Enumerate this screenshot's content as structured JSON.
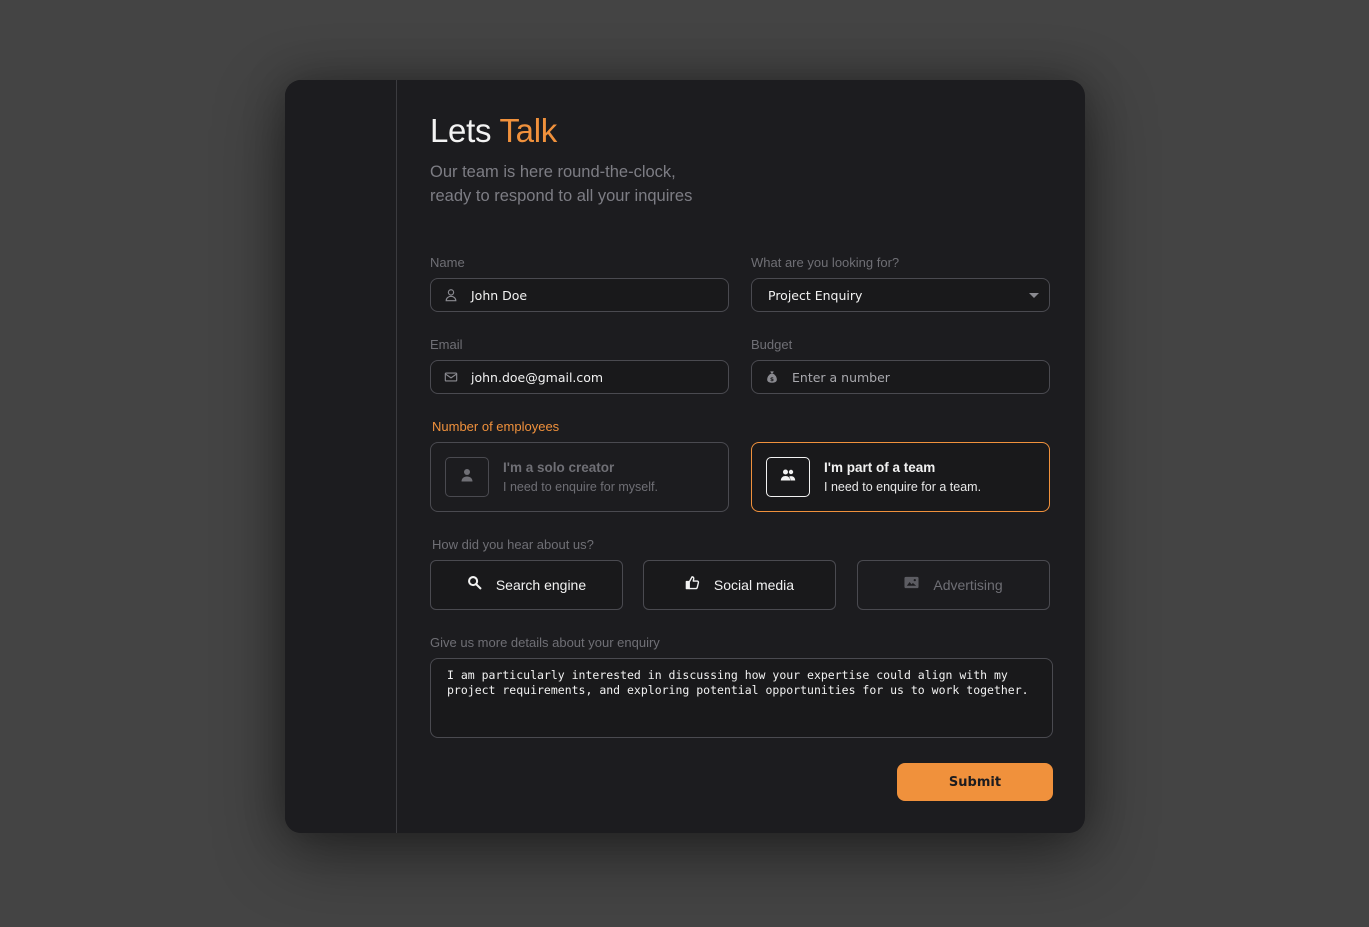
{
  "header": {
    "title_main": "Lets",
    "title_accent": "Talk",
    "subtitle_line1": "Our team is here round-the-clock,",
    "subtitle_line2": "ready to respond to all your inquires"
  },
  "fields": {
    "name": {
      "label": "Name",
      "value": "John Doe",
      "icon": "user-icon"
    },
    "looking_for": {
      "label": "What are you looking for?",
      "value": "Project Enquiry",
      "icon": "caret-down-icon"
    },
    "email": {
      "label": "Email",
      "value": "john.doe@gmail.com",
      "icon": "mail-icon"
    },
    "budget": {
      "label": "Budget",
      "placeholder": "Enter a number",
      "icon": "money-bag-icon"
    }
  },
  "employees": {
    "label": "Number of employees",
    "options": [
      {
        "title": "I'm a solo creator",
        "desc": "I need to enquire for myself.",
        "icon": "person-icon",
        "selected": false
      },
      {
        "title": "I'm part of a team",
        "desc": "I need to enquire for a team.",
        "icon": "people-icon",
        "selected": true
      }
    ]
  },
  "source": {
    "label": "How did you hear about us?",
    "options": [
      {
        "label": "Search engine",
        "icon": "search-icon",
        "selected": true
      },
      {
        "label": "Social media",
        "icon": "thumbs-up-icon",
        "selected": true
      },
      {
        "label": "Advertising",
        "icon": "ad-icon",
        "selected": false
      }
    ]
  },
  "details": {
    "label": "Give us more details about your enquiry",
    "value": "I am particularly interested in discussing how your expertise could align with my\nproject requirements, and exploring potential opportunities for us to work together."
  },
  "submit_label": "Submit",
  "colors": {
    "accent": "#f0913c",
    "card_bg": "#1c1c1f",
    "page_bg": "#444444"
  }
}
